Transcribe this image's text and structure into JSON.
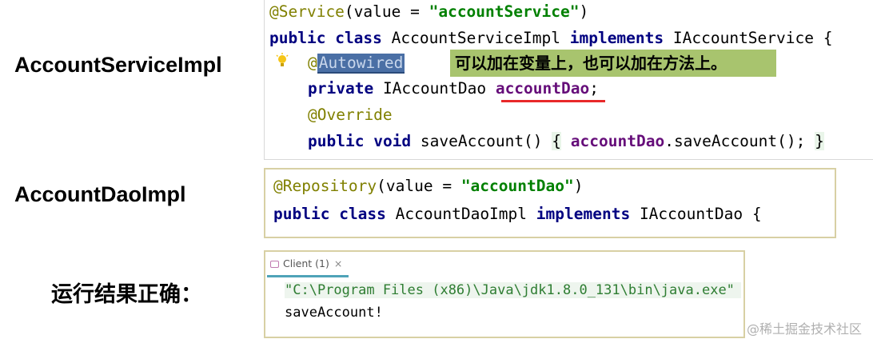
{
  "labels": {
    "service_impl": "AccountServiceImpl",
    "dao_impl": "AccountDaoImpl",
    "result": "运行结果正确："
  },
  "service_code": {
    "ann_service": "@Service",
    "ann_service_args_open": "(value = ",
    "ann_service_value": "\"accountService\"",
    "ann_service_args_close": ")",
    "kw_public": "public",
    "kw_class": "class",
    "class_name": "AccountServiceImpl",
    "kw_implements": "implements",
    "interface_name": "IAccountService {",
    "ann_at": "@",
    "ann_autowired": "Autowired",
    "note": "可以加在变量上，也可以加在方法上。",
    "kw_private": "private",
    "field_type": "IAccountDao",
    "field_name": "accountDao",
    "semicolon": ";",
    "ann_override": "@Override",
    "kw_void": "void",
    "method_sig": "saveAccount()",
    "brace_open": "{",
    "call_target": "accountDao",
    "call_rest": ".saveAccount();",
    "brace_close": "}"
  },
  "dao_code": {
    "ann_repository": "@Repository",
    "args_open": "(value = ",
    "value": "\"accountDao\"",
    "args_close": ")",
    "kw_public": "public",
    "kw_class": "class",
    "class_name": "AccountDaoImpl",
    "kw_implements": "implements",
    "interface_name": "IAccountDao {"
  },
  "console": {
    "tab_label": "Client (1)",
    "tab_close": "×",
    "command": "\"C:\\Program Files (x86)\\Java\\jdk1.8.0_131\\bin\\java.exe\"",
    "output": "saveAccount!"
  },
  "watermark": "@稀土掘金技术社区"
}
